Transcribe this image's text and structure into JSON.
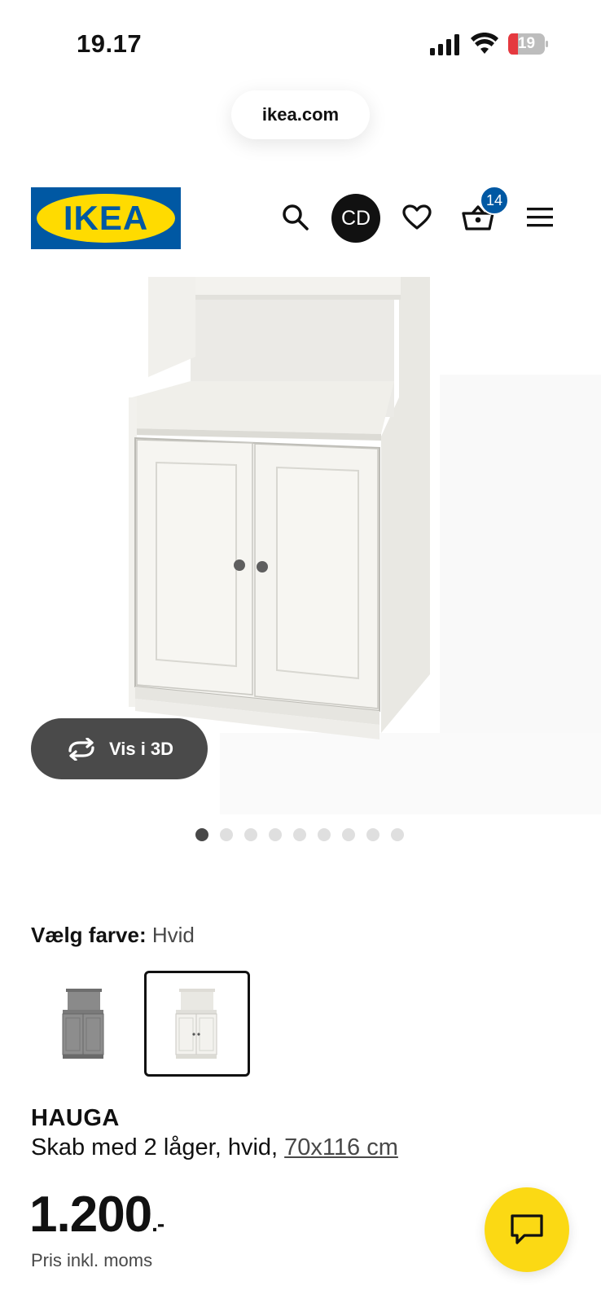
{
  "status_bar": {
    "time": "19.17",
    "battery": "19"
  },
  "browser": {
    "url": "ikea.com"
  },
  "header": {
    "logo_text": "IKEA",
    "avatar_initials": "CD",
    "cart_count": "14",
    "colors": {
      "brand_blue": "#0058a3",
      "brand_yellow": "#ffdb00"
    }
  },
  "gallery": {
    "view_3d_label": "Vis i 3D",
    "image_count": 9,
    "active_image": 1
  },
  "color_picker": {
    "label": "Vælg farve:",
    "selected_value": "Hvid",
    "options": [
      "grey-option",
      "white-option"
    ]
  },
  "product": {
    "name": "HAUGA",
    "description": "Skab med 2 låger, hvid,",
    "size": "70x116 cm",
    "price": "1.200",
    "price_suffix": ".-",
    "price_note": "Pris inkl. moms"
  },
  "chat": {
    "icon": "chat-bubble-icon",
    "color": "#fbd914"
  }
}
